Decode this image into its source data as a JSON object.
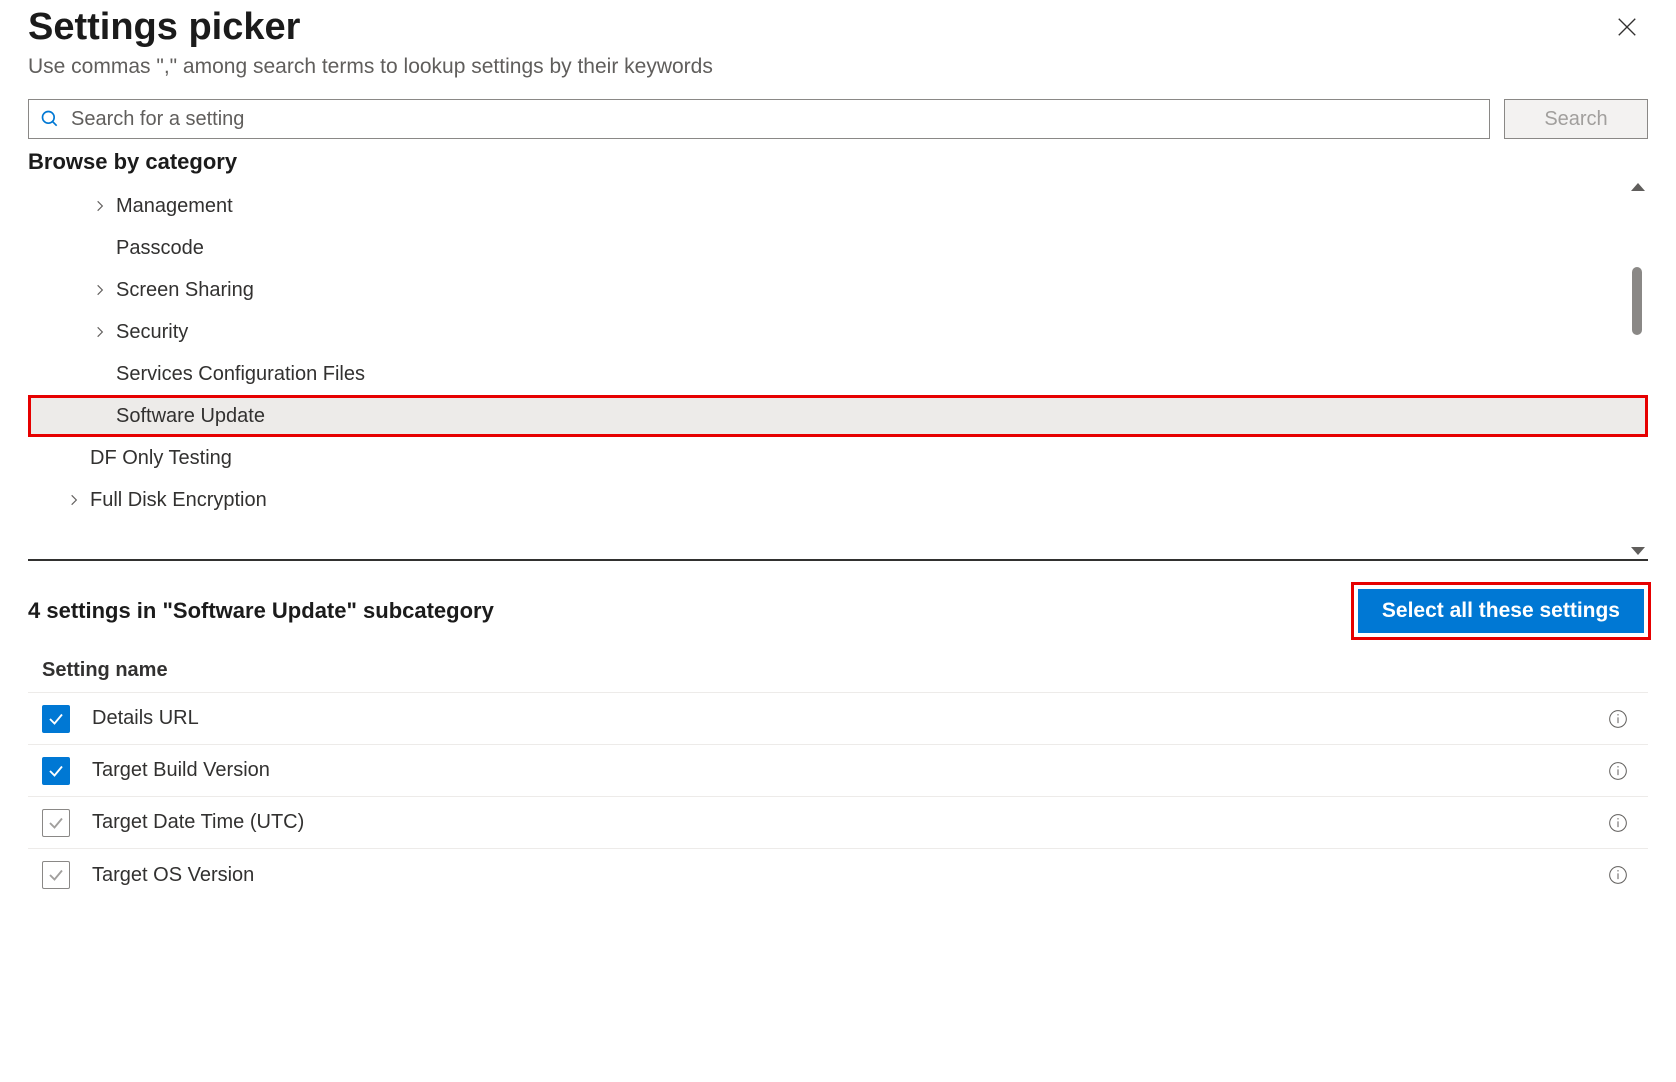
{
  "header": {
    "title": "Settings picker",
    "subtitle": "Use commas \",\" among search terms to lookup settings by their keywords"
  },
  "search": {
    "placeholder": "Search for a setting",
    "button_label": "Search"
  },
  "browse_label": "Browse by category",
  "categories": [
    {
      "label": "Management",
      "expandable": true,
      "level": 1,
      "selected": false
    },
    {
      "label": "Passcode",
      "expandable": false,
      "level": 1,
      "selected": false
    },
    {
      "label": "Screen Sharing",
      "expandable": true,
      "level": 1,
      "selected": false
    },
    {
      "label": "Security",
      "expandable": true,
      "level": 1,
      "selected": false
    },
    {
      "label": "Services Configuration Files",
      "expandable": false,
      "level": 1,
      "selected": false
    },
    {
      "label": "Software Update",
      "expandable": false,
      "level": 1,
      "selected": true,
      "highlighted": true
    },
    {
      "label": "DF Only Testing",
      "expandable": false,
      "level": 0,
      "selected": false
    },
    {
      "label": "Full Disk Encryption",
      "expandable": true,
      "level": 0,
      "selected": false
    }
  ],
  "subcategory": {
    "count_text": "4 settings in \"Software Update\" subcategory",
    "select_all_label": "Select all these settings",
    "header_label": "Setting name",
    "settings": [
      {
        "name": "Details URL",
        "checked": true
      },
      {
        "name": "Target Build Version",
        "checked": true
      },
      {
        "name": "Target Date Time (UTC)",
        "checked": false
      },
      {
        "name": "Target OS Version",
        "checked": false
      }
    ]
  }
}
